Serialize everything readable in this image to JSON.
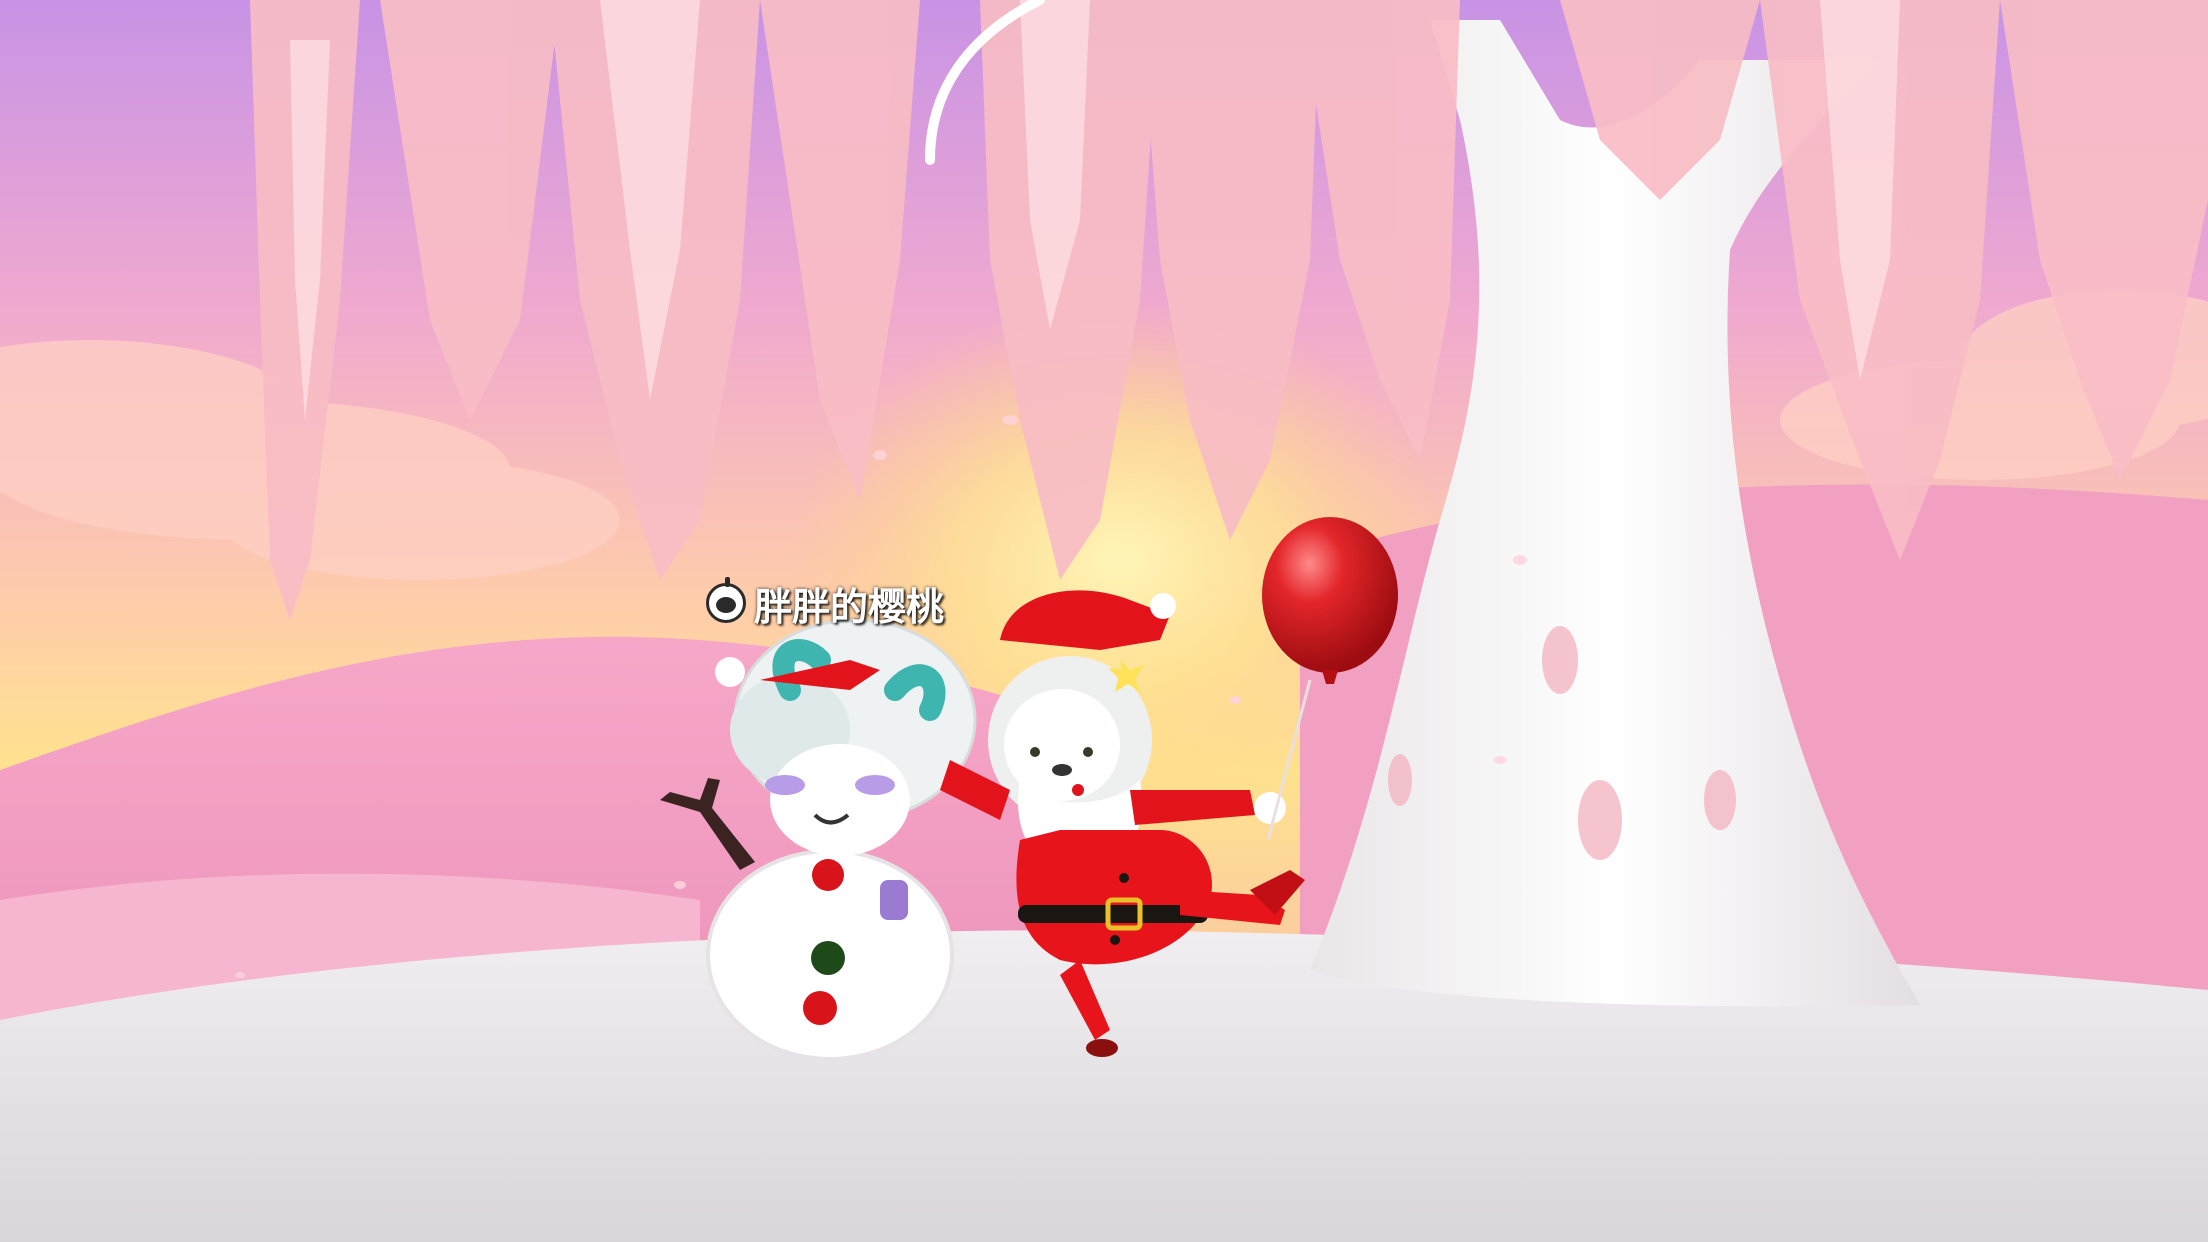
{
  "scene": {
    "player_name": "胖胖的樱桃",
    "player_icon": "player-avatar-icon",
    "palette": {
      "sky_top": "#c892e8",
      "sky_glow": "#ffe07a",
      "blossom": "#f6b3bd",
      "ground": "#e4e1e4",
      "tree_trunk": "#f4f2f2",
      "santa_red": "#e8141c",
      "balloon_red": "#d8161c"
    }
  }
}
